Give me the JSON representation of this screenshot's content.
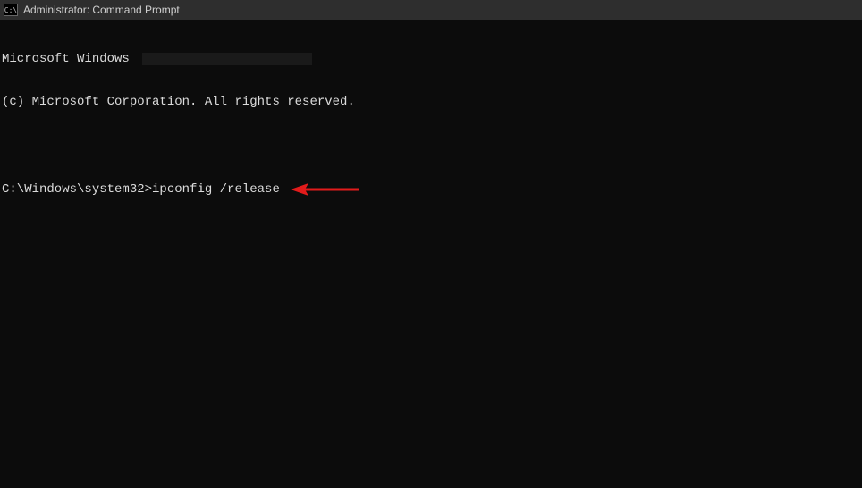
{
  "titlebar": {
    "icon_label": "C:\\",
    "title": "Administrator: Command Prompt"
  },
  "terminal": {
    "header_line1_prefix": "Microsoft Windows ",
    "header_line2": "(c) Microsoft Corporation. All rights reserved.",
    "prompt_path": "C:\\Windows\\system32>",
    "command": "ipconfig /release"
  },
  "annotation": {
    "arrow_color": "#e21b1b"
  }
}
